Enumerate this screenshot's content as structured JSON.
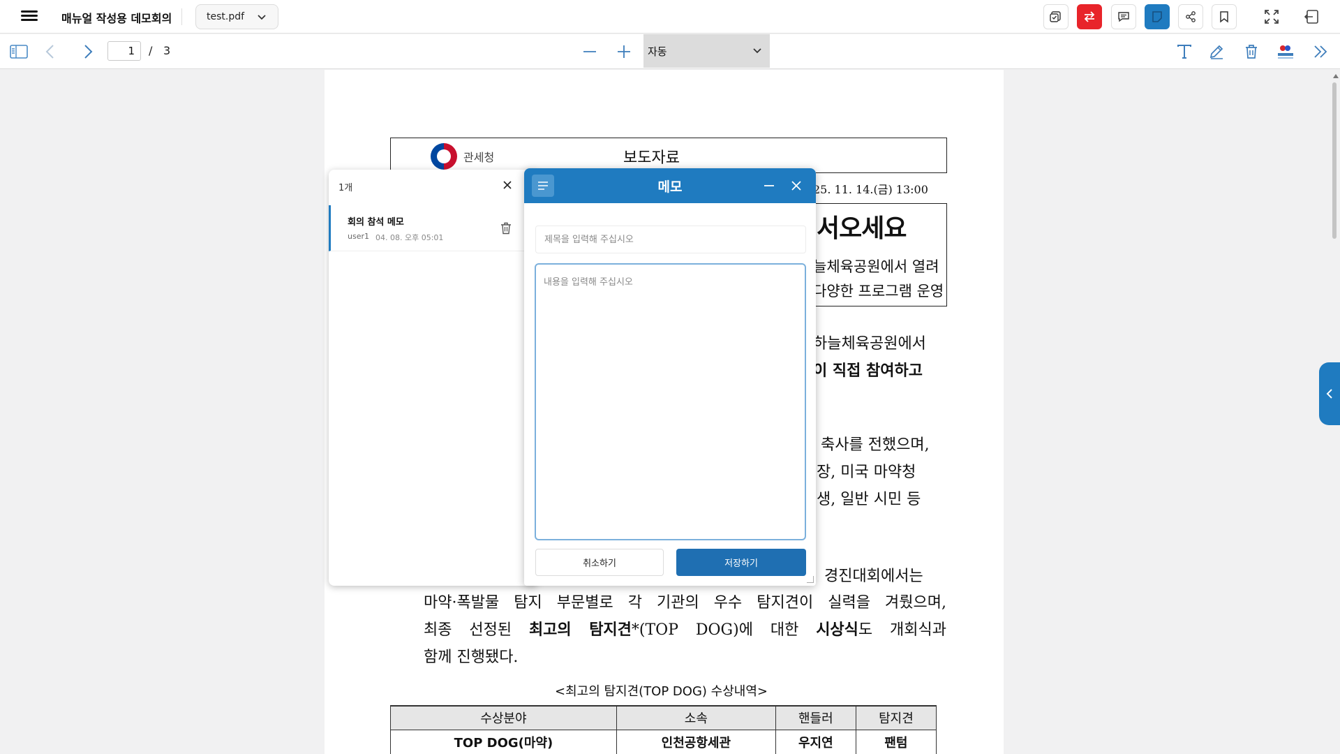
{
  "app": {
    "title": "매뉴얼 작성용 데모회의",
    "file": "test.pdf"
  },
  "topbar": {
    "icons": [
      "sync-check-icon",
      "swap-icon",
      "comment-icon",
      "memo-icon",
      "share-icon",
      "bookmark-icon",
      "fullscreen-icon",
      "exit-icon"
    ],
    "colors": {
      "red_button": "#e8242a",
      "active_button": "#1f7bc0"
    }
  },
  "toolbar": {
    "page_current": "1",
    "page_separator": "/",
    "page_total": "3",
    "zoom": "자동"
  },
  "document": {
    "agency": "관세청",
    "press_label": "보도자료",
    "date": "25. 11. 14.(금) 13:00",
    "headline": "서오세요",
    "sub1": "늘체육공원에서 열려",
    "sub2": "다양한 프로그램 운영",
    "para1_line1": "하늘체육공원에서",
    "para1_line2": "이 직접 참여하고",
    "para2_line1": "축사를 전했으며,",
    "para2_line2": "장, 미국 마약청",
    "para2_line3": "생, 일반 시민 등",
    "para3_line1": "경진대회에서는",
    "para3_line2": "마약·폭발물 탐지 부문별로 각 기관의 우수 탐지견이 실력을 겨뤘으며,",
    "para3_line3_a": "최종 선정된 ",
    "para3_line3_b": "최고의 탐지견",
    "para3_line3_c": "*(TOP DOG)에 대한 ",
    "para3_line3_d": "시상식",
    "para3_line3_e": "도 개회식과",
    "para3_line4": "함께 진행됐다.",
    "table_caption": "<최고의 탐지견(TOP DOG) 수상내역>",
    "table_headers": [
      "수상분야",
      "소속",
      "핸들러",
      "탐지견"
    ],
    "table_row": [
      "TOP DOG(마약)",
      "인천공항세관",
      "우지연",
      "팬텀"
    ]
  },
  "memo_list": {
    "count": "1개",
    "items": [
      {
        "title": "회의 참석 메모",
        "user": "user1",
        "date": "04. 08. 오후 05:01"
      }
    ]
  },
  "memo_dialog": {
    "title": "메모",
    "title_placeholder": "제목을 입력해 주십시오",
    "body_placeholder": "내용을 입력해 주십시오",
    "cancel": "취소하기",
    "save": "저장하기"
  }
}
